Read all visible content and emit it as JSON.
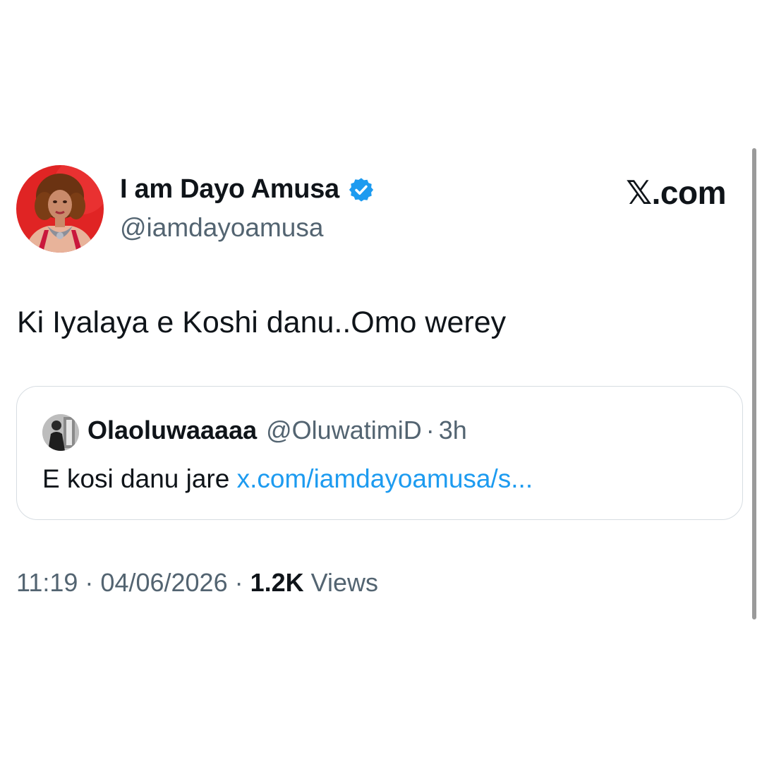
{
  "author": {
    "display_name": "I am Dayo Amusa",
    "handle": "@iamdayoamusa",
    "verified_icon": "verified-badge-icon"
  },
  "brand": {
    "label": "𝕏.com"
  },
  "tweet": {
    "text": "Ki Iyalaya e Koshi danu..Omo werey"
  },
  "quoted_tweet": {
    "author_name": "Olaoluwaaaaa",
    "author_handle": "@OluwatimiD",
    "separator": "·",
    "age": "3h",
    "text": "E kosi danu jare ",
    "link": "x.com/iamdayoamusa/s..."
  },
  "meta": {
    "time": "11:19",
    "sep1": " · ",
    "date": "04/06/2026",
    "sep2": " · ",
    "views_count": "1.2K",
    "views_label": " Views"
  },
  "colors": {
    "text": "#0f1419",
    "muted": "#536471",
    "link": "#1d9bf0",
    "verified": "#1d9bf0",
    "avatar_bg": "#e02424"
  }
}
